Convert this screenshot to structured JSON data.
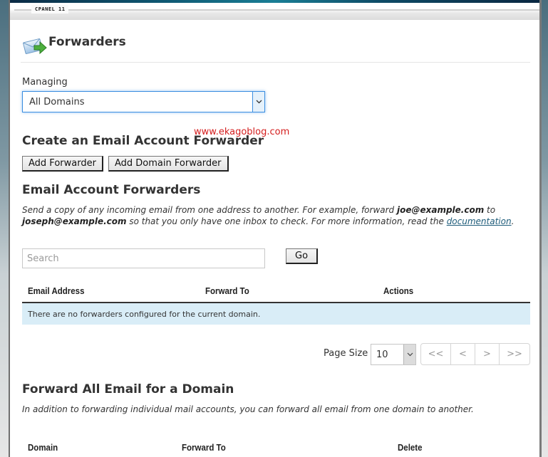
{
  "window": {
    "brand": "CPANEL 11"
  },
  "header": {
    "title": "Forwarders",
    "icon": "mail-forward-icon"
  },
  "managing": {
    "label": "Managing",
    "selected": "All Domains"
  },
  "watermark": "www.ekagoblog.com",
  "create_section": {
    "title": "Create an Email Account Forwarder",
    "buttons": {
      "add_forwarder": "Add Forwarder",
      "add_domain_forwarder": "Add Domain Forwarder"
    }
  },
  "email_forwarders": {
    "title": "Email Account Forwarders",
    "description": {
      "part1": "Send a copy of any incoming email from one address to another. For example, forward ",
      "example_from": "joe@example.com",
      "part2": " to ",
      "example_to": "joseph@example.com",
      "part3": " so that you only have one inbox to check. For more information, read the ",
      "link": "documentation",
      "part4": "."
    },
    "search": {
      "placeholder": "Search",
      "value": "",
      "go_label": "Go"
    },
    "table": {
      "columns": [
        "Email Address",
        "Forward To",
        "Actions"
      ],
      "empty_message": "There are no forwarders configured for the current domain."
    },
    "pagination": {
      "page_size_label": "Page Size",
      "page_size": "10",
      "first": "<<",
      "prev": "<",
      "next": ">",
      "last": ">>"
    }
  },
  "domain_forwarders": {
    "title": "Forward All Email for a Domain",
    "description": "In addition to forwarding individual mail accounts, you can forward all email from one domain to another.",
    "table": {
      "columns": [
        "Domain",
        "Forward To",
        "Delete"
      ]
    }
  },
  "colors": {
    "accent_focus": "#3b8ee0",
    "empty_row_bg": "#d9edf7",
    "watermark": "#d41e1e",
    "link": "#1e5c7a"
  }
}
